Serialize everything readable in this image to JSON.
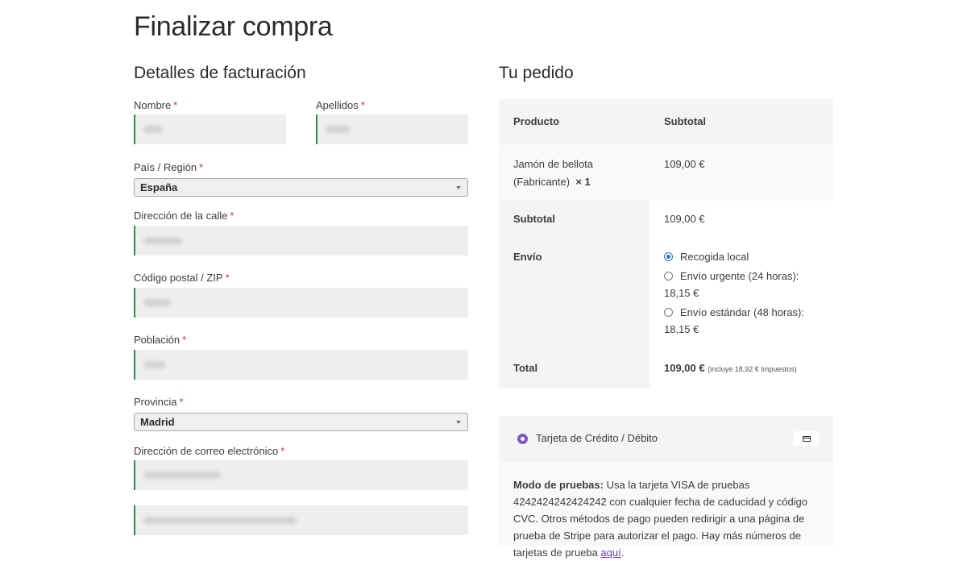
{
  "page": {
    "title": "Finalizar compra"
  },
  "billing": {
    "title": "Detalles de facturación",
    "required_mark": "*",
    "fields": {
      "first_name": {
        "label": "Nombre"
      },
      "last_name": {
        "label": "Apellidos"
      },
      "country": {
        "label": "País / Región",
        "value": "España"
      },
      "street": {
        "label": "Dirección de la calle"
      },
      "postcode": {
        "label": "Código postal / ZIP"
      },
      "city": {
        "label": "Población"
      },
      "province": {
        "label": "Provincia",
        "value": "Madrid"
      },
      "email": {
        "label": "Dirección de correo electrónico"
      }
    }
  },
  "order": {
    "title": "Tu pedido",
    "headers": {
      "product": "Producto",
      "subtotal": "Subtotal"
    },
    "item": {
      "name_line1": "Jamón de bellota",
      "name_line2": "(Fabricante)",
      "qty": "× 1",
      "price": "109,00 €"
    },
    "subtotal": {
      "label": "Subtotal",
      "value": "109,00 €"
    },
    "shipping": {
      "label": "Envío",
      "options": [
        {
          "label": "Recogida local",
          "checked": true
        },
        {
          "label": "Envío urgente (24 horas):",
          "price": "18,15 €",
          "checked": false
        },
        {
          "label": "Envío estándar (48 horas):",
          "price": "18,15 €",
          "checked": false
        }
      ]
    },
    "total": {
      "label": "Total",
      "value": "109,00 €",
      "note": "(incluye 18,92 € Impuestos)"
    }
  },
  "payment": {
    "method": "Tarjeta de Crédito / Débito",
    "icon": "credit-card-icon",
    "test_mode_label": "Modo de pruebas:",
    "test_mode_text": "Usa la tarjeta VISA de pruebas 4242424242424242 con cualquier fecha de caducidad y código CVC. Otros métodos de pago pueden redirigir a una página de prueba de Stripe para autorizar el pago. Hay más números de tarjetas de prueba",
    "link_text": "aquí",
    "end": "."
  },
  "colors": {
    "accent_green": "#2e8b57",
    "radio_blue": "#2a6fd6",
    "pay_purple": "#7e57c2",
    "required_red": "#c0392b"
  }
}
